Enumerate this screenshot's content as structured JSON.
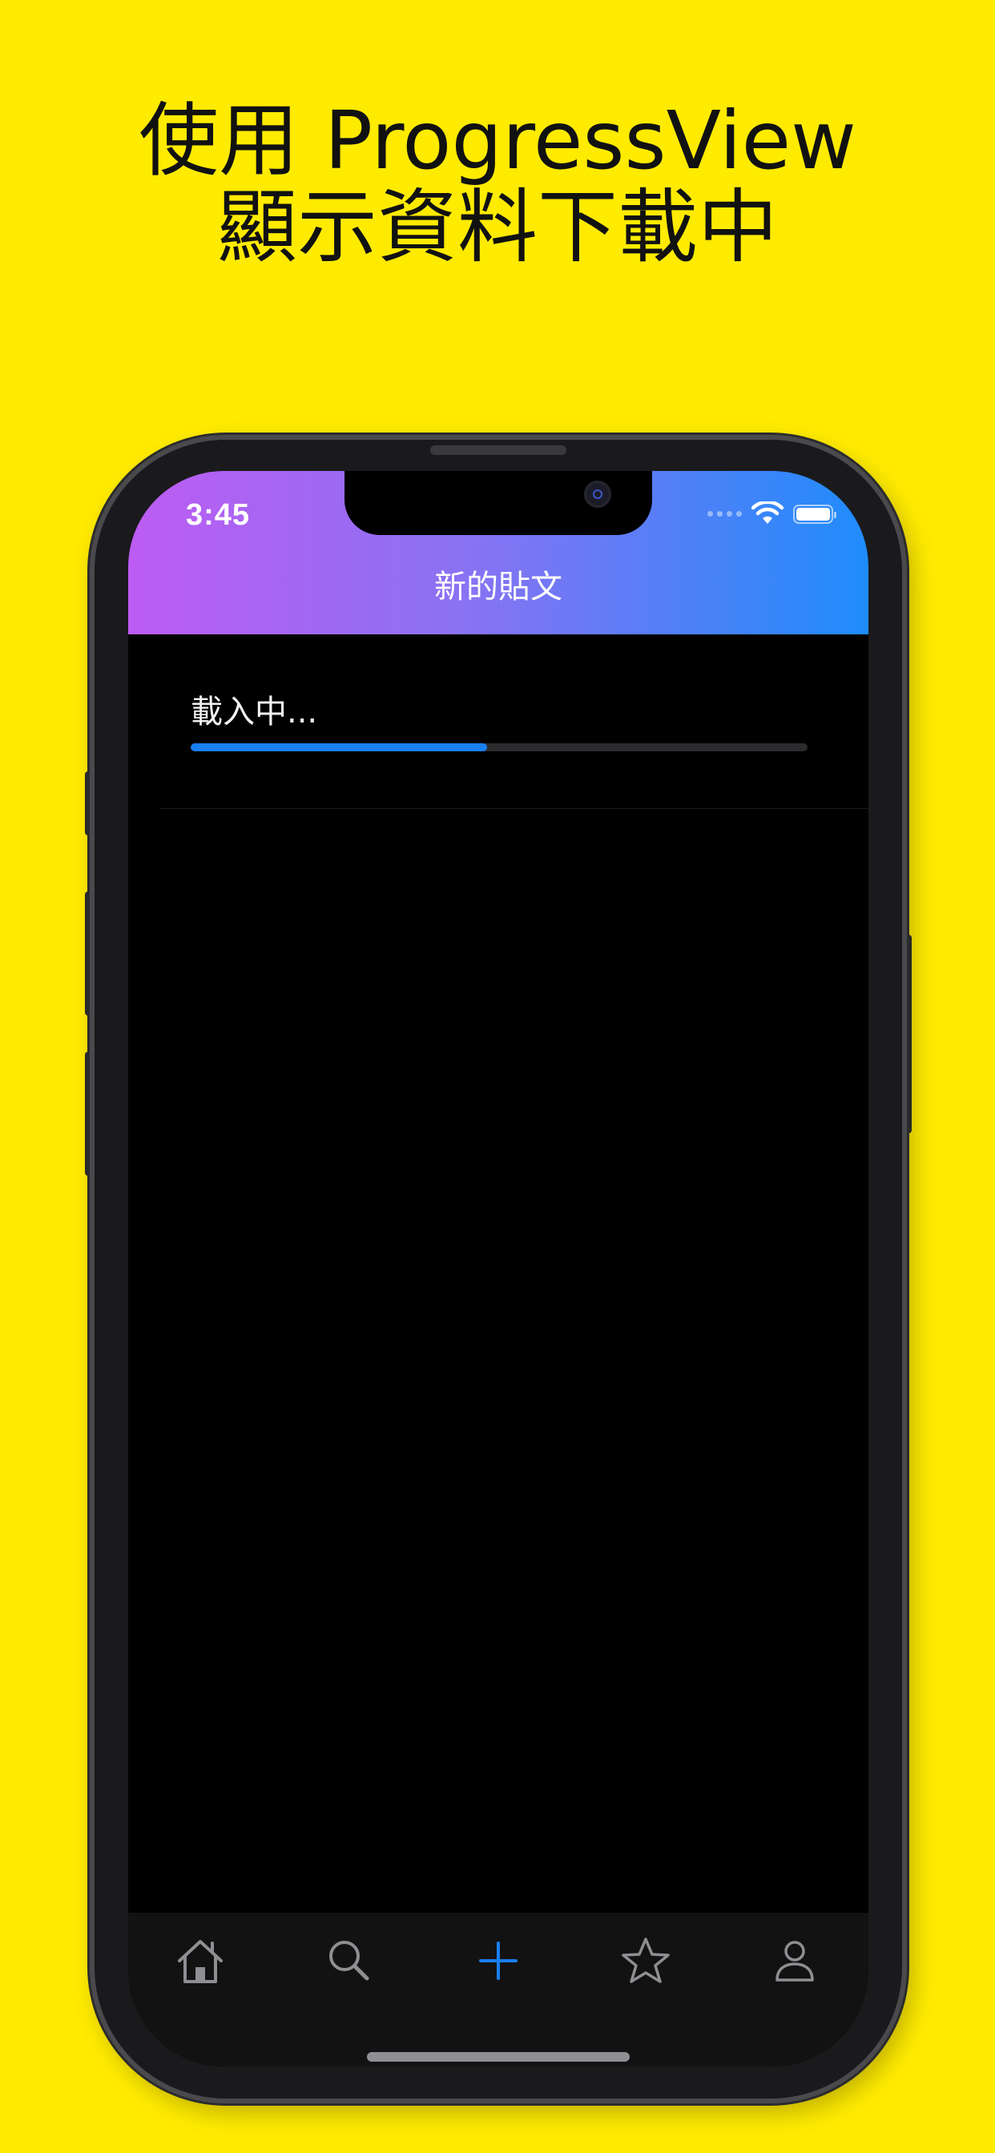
{
  "caption": {
    "line1": "使用 ProgressView",
    "line2": "顯示資料下載中"
  },
  "status_bar": {
    "time": "3:45",
    "wifi_icon": "wifi-icon",
    "battery_icon": "battery-icon"
  },
  "nav": {
    "title": "新的貼文"
  },
  "loading": {
    "label": "載入中...",
    "progress": 0.48
  },
  "tab_bar": {
    "items": [
      {
        "icon": "house-icon",
        "selected": false
      },
      {
        "icon": "search-icon",
        "selected": false
      },
      {
        "icon": "plus-icon",
        "selected": true
      },
      {
        "icon": "star-icon",
        "selected": false
      },
      {
        "icon": "person-icon",
        "selected": false
      }
    ]
  },
  "colors": {
    "background": "#ffeb00",
    "header_gradient_start": "#bd5cf2",
    "header_gradient_end": "#1f8cfb",
    "accent": "#1a7ff0",
    "tab_inactive": "#8e8e93"
  }
}
